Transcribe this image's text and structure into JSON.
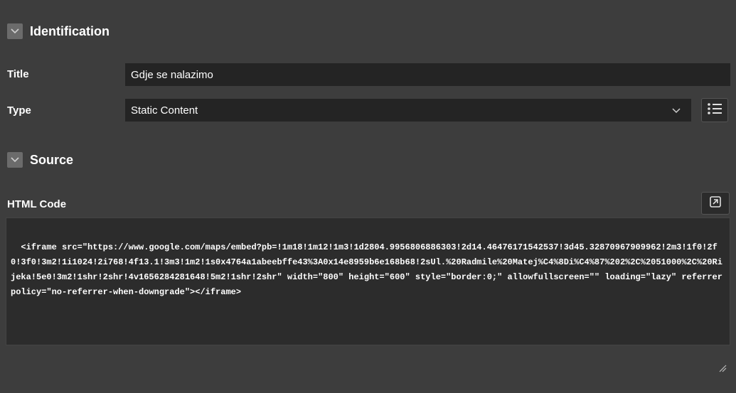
{
  "identification": {
    "section_title": "Identification",
    "title_label": "Title",
    "title_value": "Gdje se nalazimo",
    "type_label": "Type",
    "type_value": "Static Content",
    "list_icon": "list-view-icon"
  },
  "source": {
    "section_title": "Source",
    "html_code_label": "HTML Code",
    "expand_icon": "expand-editor-icon",
    "html_code_value": "<iframe src=\"https://www.google.com/maps/embed?pb=!1m18!1m12!1m3!1d2804.9956806886303!2d14.46476171542537!3d45.32870967909962!2m3!1f0!2f0!3f0!3m2!1i1024!2i768!4f13.1!3m3!1m2!1s0x4764a1abeebffe43%3A0x14e8959b6e168b68!2sUl.%20Radmile%20Matej%C4%8Di%C4%87%202%2C%2051000%2C%20Rijeka!5e0!3m2!1shr!2shr!4v1656284281648!5m2!1shr!2shr\" width=\"800\" height=\"600\" style=\"border:0;\" allowfullscreen=\"\" loading=\"lazy\" referrerpolicy=\"no-referrer-when-downgrade\"></iframe>"
  },
  "colors": {
    "background": "#3d3d3d",
    "field": "#242424",
    "code_background": "#2c2c2c"
  }
}
